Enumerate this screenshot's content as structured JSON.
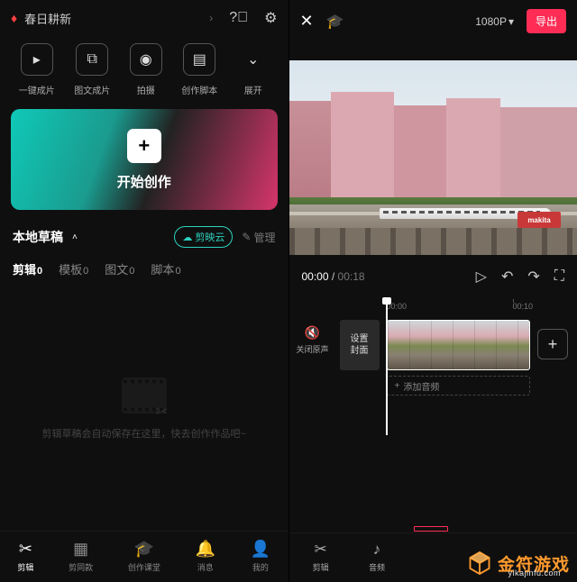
{
  "left": {
    "topic": "春日耕新",
    "actions": [
      {
        "label": "一键成片",
        "icon": "▢"
      },
      {
        "label": "图文成片",
        "icon": "⌼"
      },
      {
        "label": "拍摄",
        "icon": "◎"
      },
      {
        "label": "创作脚本",
        "icon": "▤"
      },
      {
        "label": "展开",
        "icon": "⌄"
      }
    ],
    "hero_label": "开始创作",
    "drafts_title": "本地草稿",
    "cloud_label": "剪映云",
    "manage_label": "管理",
    "draft_tabs": [
      {
        "label": "剪辑",
        "count": "0",
        "active": true
      },
      {
        "label": "模板",
        "count": "0"
      },
      {
        "label": "图文",
        "count": "0"
      },
      {
        "label": "脚本",
        "count": "0"
      }
    ],
    "empty_msg": "剪辑草稿会自动保存在这里，快去创作作品吧~",
    "nav": [
      {
        "label": "剪辑",
        "active": true
      },
      {
        "label": "剪同款"
      },
      {
        "label": "创作课堂"
      },
      {
        "label": "消息"
      },
      {
        "label": "我的"
      }
    ]
  },
  "right": {
    "resolution": "1080P",
    "export_label": "导出",
    "billboard": "makita",
    "time_current": "00:00",
    "time_total": "00:18",
    "ruler": [
      "00:00",
      "00:10"
    ],
    "mute_label": "关闭原声",
    "cover_label_1": "设置",
    "cover_label_2": "封面",
    "add_audio": "添加音频",
    "bottom_nav": [
      {
        "label": "剪辑"
      },
      {
        "label": "音频"
      }
    ]
  },
  "watermark": {
    "brand": "金符游戏",
    "url": "yikajinfu.com"
  }
}
